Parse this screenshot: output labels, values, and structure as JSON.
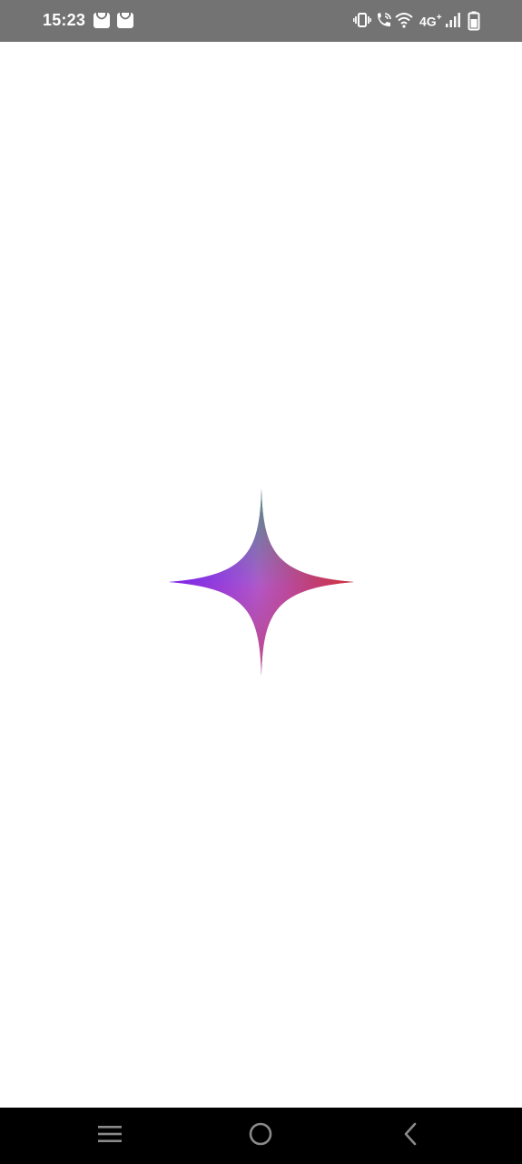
{
  "status_bar": {
    "time": "15:23",
    "notification_icons": [
      "mail-bag-icon",
      "mail-bag-icon"
    ],
    "system_icons": [
      "vibrate-icon",
      "wifi-call-icon",
      "wifi-icon",
      "signal-icon",
      "battery-icon"
    ],
    "network_type": "4G",
    "network_suffix": "+",
    "background_color": "#737373"
  },
  "main": {
    "logo_icon": "sparkle-icon",
    "logo_colors": {
      "top": "#4d9a7e",
      "left": "#7c2ee6",
      "right": "#d93a3a",
      "bottom": "#c0457a",
      "center": "#a24be8"
    }
  },
  "nav_bar": {
    "buttons": [
      "recent-apps-icon",
      "home-icon",
      "back-icon"
    ],
    "background_color": "#000000"
  }
}
